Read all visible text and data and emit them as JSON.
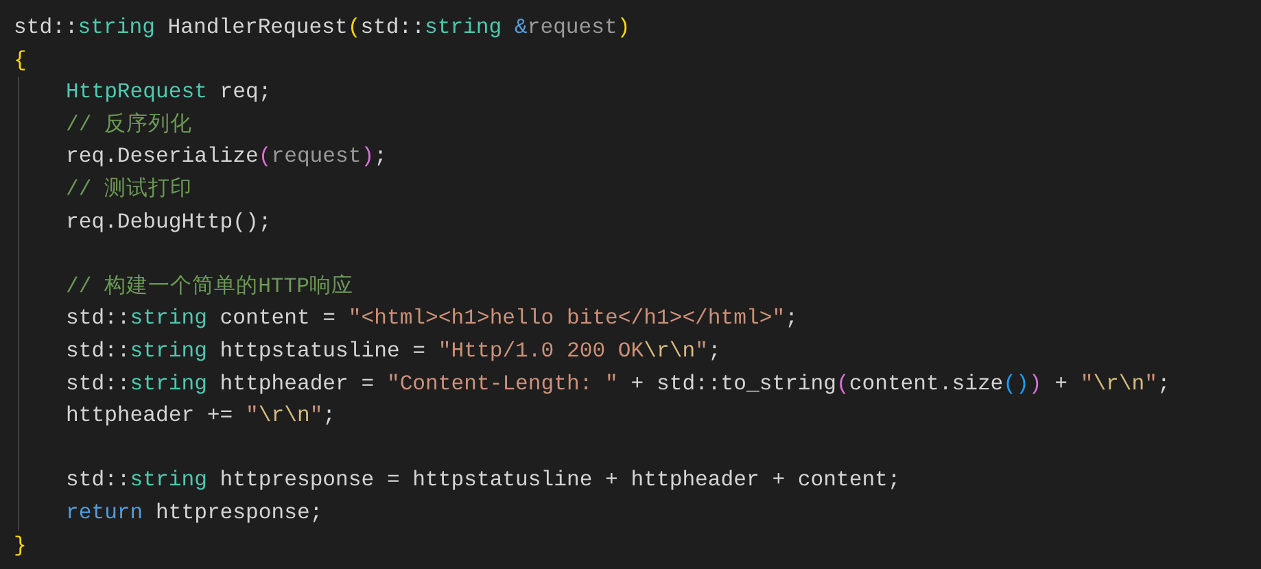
{
  "editor": {
    "lines": [
      {
        "kind": "code",
        "tokens": [
          {
            "kind": "plain",
            "text": "std::"
          },
          {
            "kind": "type",
            "text": "string"
          },
          {
            "kind": "plain",
            "text": " HandlerRequest"
          },
          {
            "kind": "bracket1",
            "text": "("
          },
          {
            "kind": "plain",
            "text": "std::"
          },
          {
            "kind": "type",
            "text": "string"
          },
          {
            "kind": "keyword",
            "text": " &"
          },
          {
            "kind": "param",
            "text": "request"
          },
          {
            "kind": "bracket1",
            "text": ")"
          }
        ]
      },
      {
        "kind": "code",
        "tokens": [
          {
            "kind": "bracket1",
            "text": "{"
          }
        ]
      },
      {
        "kind": "block",
        "children": [
          {
            "kind": "code",
            "tokens": [
              {
                "kind": "type",
                "text": "HttpRequest"
              },
              {
                "kind": "plain",
                "text": " req;"
              }
            ]
          },
          {
            "kind": "code",
            "tokens": [
              {
                "kind": "comment",
                "text": "// 反序列化"
              }
            ]
          },
          {
            "kind": "code",
            "tokens": [
              {
                "kind": "plain",
                "text": "req.Deserialize"
              },
              {
                "kind": "bracket2",
                "text": "("
              },
              {
                "kind": "param",
                "text": "request"
              },
              {
                "kind": "bracket2",
                "text": ")"
              },
              {
                "kind": "plain",
                "text": ";"
              }
            ]
          },
          {
            "kind": "code",
            "tokens": [
              {
                "kind": "comment",
                "text": "// 测试打印"
              }
            ]
          },
          {
            "kind": "code",
            "tokens": [
              {
                "kind": "plain",
                "text": "req.DebugHttp();"
              }
            ]
          },
          {
            "kind": "blank"
          },
          {
            "kind": "code",
            "tokens": [
              {
                "kind": "comment",
                "text": "// 构建一个简单的HTTP响应"
              }
            ]
          },
          {
            "kind": "code",
            "tokens": [
              {
                "kind": "plain",
                "text": "std::"
              },
              {
                "kind": "type",
                "text": "string"
              },
              {
                "kind": "plain",
                "text": " content = "
              },
              {
                "kind": "string",
                "text": "\"<html><h1>hello bite</h1></html>\""
              },
              {
                "kind": "plain",
                "text": ";"
              }
            ]
          },
          {
            "kind": "code",
            "tokens": [
              {
                "kind": "plain",
                "text": "std::"
              },
              {
                "kind": "type",
                "text": "string"
              },
              {
                "kind": "plain",
                "text": " httpstatusline = "
              },
              {
                "kind": "string",
                "text": "\"Http/1.0 200 OK"
              },
              {
                "kind": "escape",
                "text": "\\r\\n"
              },
              {
                "kind": "string",
                "text": "\""
              },
              {
                "kind": "plain",
                "text": ";"
              }
            ]
          },
          {
            "kind": "code",
            "tokens": [
              {
                "kind": "plain",
                "text": "std::"
              },
              {
                "kind": "type",
                "text": "string"
              },
              {
                "kind": "plain",
                "text": " httpheader = "
              },
              {
                "kind": "string",
                "text": "\"Content-Length: \""
              },
              {
                "kind": "plain",
                "text": " + std::to_string"
              },
              {
                "kind": "bracket2",
                "text": "("
              },
              {
                "kind": "plain",
                "text": "content.size"
              },
              {
                "kind": "bracket3",
                "text": "()"
              },
              {
                "kind": "bracket2",
                "text": ")"
              },
              {
                "kind": "plain",
                "text": " + "
              },
              {
                "kind": "string",
                "text": "\""
              },
              {
                "kind": "escape",
                "text": "\\r\\n"
              },
              {
                "kind": "string",
                "text": "\""
              },
              {
                "kind": "plain",
                "text": ";"
              }
            ]
          },
          {
            "kind": "code",
            "tokens": [
              {
                "kind": "plain",
                "text": "httpheader += "
              },
              {
                "kind": "string",
                "text": "\""
              },
              {
                "kind": "escape",
                "text": "\\r\\n"
              },
              {
                "kind": "string",
                "text": "\""
              },
              {
                "kind": "plain",
                "text": ";"
              }
            ]
          },
          {
            "kind": "blank"
          },
          {
            "kind": "code",
            "tokens": [
              {
                "kind": "plain",
                "text": "std::"
              },
              {
                "kind": "type",
                "text": "string"
              },
              {
                "kind": "plain",
                "text": " httpresponse = httpstatusline + httpheader + content;"
              }
            ]
          },
          {
            "kind": "code",
            "tokens": [
              {
                "kind": "keyword",
                "text": "return"
              },
              {
                "kind": "plain",
                "text": " httpresponse;"
              }
            ]
          }
        ]
      },
      {
        "kind": "code",
        "tokens": [
          {
            "kind": "bracket1",
            "text": "}"
          }
        ]
      }
    ]
  }
}
